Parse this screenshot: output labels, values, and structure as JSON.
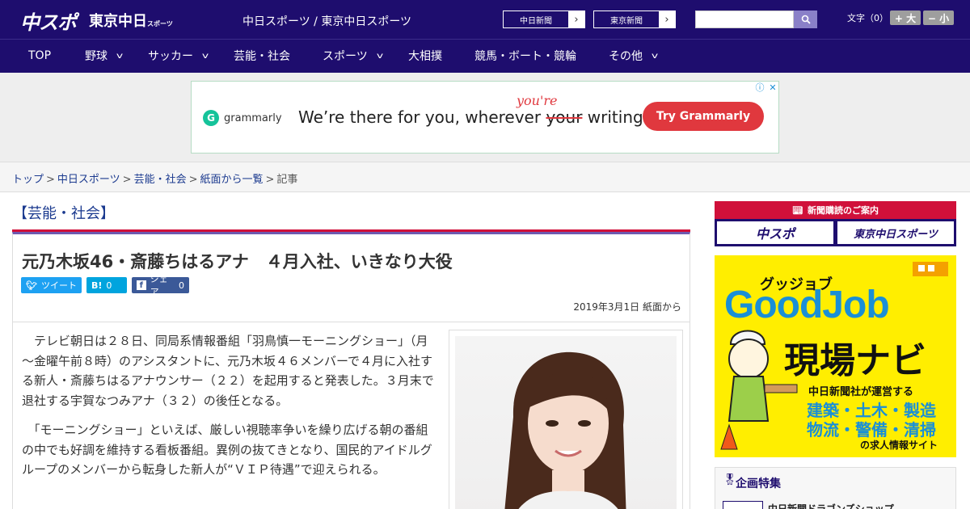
{
  "header": {
    "logo_chuspo": "中スポ",
    "logo_tokyo": "東京中日",
    "logo_tokyo_sub": "スポーツ",
    "site_names": "中日スポーツ / 東京中日スポーツ",
    "ext_links": [
      "中日新聞",
      "東京新聞"
    ],
    "search_placeholder": "",
    "font_size_label": "文字（0）",
    "font_plus": "+ 大",
    "font_minus": "− 小"
  },
  "nav": {
    "items": [
      {
        "label": "TOP",
        "dropdown": false
      },
      {
        "label": "野球",
        "dropdown": true
      },
      {
        "label": "サッカー",
        "dropdown": true
      },
      {
        "label": "芸能・社会",
        "dropdown": false
      },
      {
        "label": "スポーツ",
        "dropdown": true
      },
      {
        "label": "大相撲",
        "dropdown": false
      },
      {
        "label": "競馬・ボート・競輪",
        "dropdown": false
      },
      {
        "label": "その他",
        "dropdown": true
      }
    ]
  },
  "ad": {
    "brand": "grammarly",
    "text_before": "We’re there for you, wherever ",
    "text_struck": "your",
    "text_after": " writing.",
    "handwritten": "you're",
    "cta": "Try Grammarly"
  },
  "breadcrumb": {
    "items": [
      "トップ",
      "中日スポーツ",
      "芸能・社会",
      "紙面から一覧"
    ],
    "current": "記事",
    "separator": ">"
  },
  "article": {
    "category": "【芸能・社会】",
    "headline": "元乃木坂46・斎藤ちはるアナ　４月入社、いきなり大役",
    "share": {
      "tweet": "ツイート",
      "hatena": "B!",
      "hatena_count": "0",
      "facebook": "シェア",
      "facebook_count": "0"
    },
    "date": "2019年3月1日 紙面から",
    "paragraphs": [
      "　テレビ朝日は２８日、同局系情報番組「羽鳥慎一モーニングショー」（月～金曜午前８時）のアシスタントに、元乃木坂４６メンバーで４月に入社する新人・斎藤ちはるアナウンサー（２２）を起用すると発表した。３月末で退社する宇賀なつみアナ（３２）の後任となる。",
      "　「モーニングショー」といえば、厳しい視聴率争いを繰り広げる朝の番組の中でも好調を維持する看板番組。異例の抜てきとなり、国民的アイドルグループのメンバーから転身した新人が“ＶＩＰ待遇”で迎えられる。"
    ]
  },
  "sidebar": {
    "subscribe_title": "新聞購読のご案内",
    "subscribe_buttons": [
      "中スポ",
      "東京中日スポーツ"
    ],
    "goodjob": {
      "kicker": "グッジョブ",
      "title": "GoodJob",
      "subtitle": "現場ナビ",
      "line1": "中日新聞社が運営する",
      "line2": "建築・土木・製造",
      "line3": "物流・警備・清掃",
      "line4": "の求人情報サイト"
    },
    "feature_title": "企画特集",
    "feature_item": "中日新聞ドラゴンズショップ"
  },
  "colors": {
    "header_bg": "#1e0d6e",
    "accent_red": "#d0103a",
    "accent_purple": "#6e5ab0",
    "twitter": "#1da1f2",
    "hatena": "#00a4de",
    "facebook": "#3b5998",
    "goodjob_yellow": "#ffee00",
    "goodjob_blue": "#1a8fd6",
    "grammarly_red": "#e0383e"
  }
}
